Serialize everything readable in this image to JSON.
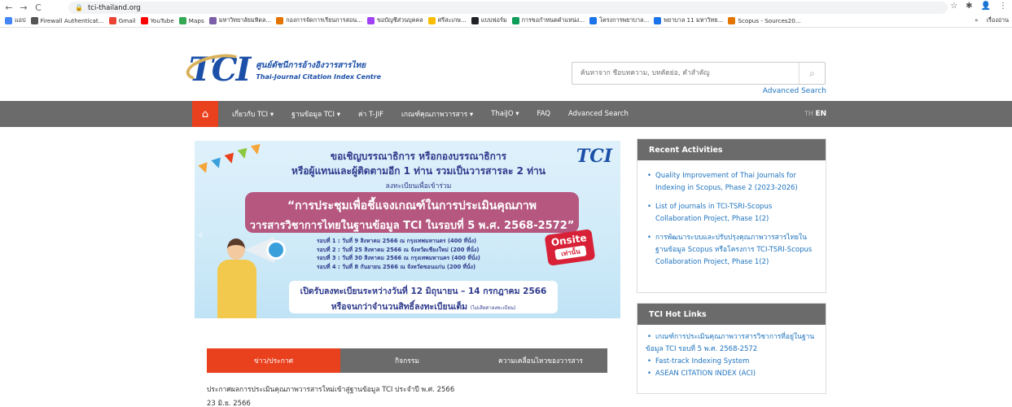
{
  "browser": {
    "url": "tci-thailand.org",
    "back": "←",
    "forward": "→",
    "reload": "C",
    "lock": "🔒",
    "right_icons": [
      "☆",
      "✱",
      "👤",
      "⋮"
    ],
    "bookmarks": [
      {
        "label": "แอป",
        "color": "#4285f4"
      },
      {
        "label": "Firewall Authenticat...",
        "color": "#555555"
      },
      {
        "label": "Gmail",
        "color": "#ea4335"
      },
      {
        "label": "YouTube",
        "color": "#ff0000"
      },
      {
        "label": "Maps",
        "color": "#34a853"
      },
      {
        "label": "มหาวิทยาลัยมหิดล...",
        "color": "#7b5ea7"
      },
      {
        "label": "กองการจัดการเรียนการสอน...",
        "color": "#e37400"
      },
      {
        "label": "ขอบัญชีส่วนบุคคล",
        "color": "#a142f4"
      },
      {
        "label": "ศรีสะเกษ...",
        "color": "#fbbc04"
      },
      {
        "label": "แบบฟอร์ม",
        "color": "#202124"
      },
      {
        "label": "การขอกำหนดตำแหน่ง...",
        "color": "#0f9d58"
      },
      {
        "label": "โครงการพยาบาล...",
        "color": "#1a73e8"
      },
      {
        "label": "พยาบาล 11 มหาวิทย...",
        "color": "#1a73e8"
      },
      {
        "label": "Scopus - Sources20...",
        "color": "#e37400"
      }
    ],
    "bookmarks_more": "»",
    "bookmarks_other": "เรื่องอ่าน"
  },
  "header": {
    "logo_mark": "TCI",
    "logo_thai": "ศูนย์ดัชนีการอ้างอิงวารสารไทย",
    "logo_eng": "Thai-Journal Citation Index Centre",
    "search_placeholder": "ค้นหาจาก ชื่อบทความ, บทคัดย่อ, คำสำคัญ",
    "search_icon": "⌕",
    "advanced_search": "Advanced Search"
  },
  "nav": {
    "home_icon": "⌂",
    "items": [
      "เกี่ยวกับ TCI ▾",
      "ฐานข้อมูล TCI ▾",
      "ค่า T-JIF",
      "เกณฑ์คุณภาพวารสาร ▾",
      "ThaiJO ▾",
      "FAQ",
      "Advanced Search"
    ],
    "lang_th": "TH",
    "lang_en": "EN"
  },
  "banner": {
    "line1": "ขอเชิญบรรณาธิการ หรือกองบรรณาธิการ",
    "line2": "หรือผู้แทนและผู้ติดตามอีก 1 ท่าน รวมเป็นวารสารละ 2 ท่าน",
    "line3": "ลงทะเบียนเพื่อเข้าร่วม",
    "logo": "TCI",
    "pill1": "“การประชุมเพื่อชี้แจงเกณฑ์ในการประเมินคุณภาพ",
    "pill2": "วารสารวิชาการไทยในฐานข้อมูล TCI ในรอบที่ 5 พ.ศ. 2568-2572”",
    "round1": "รอบที่ 1 : วันที่ 9 สิงหาคม 2566 ณ กรุงเทพมหานคร (400 ที่นั่ง)",
    "round2": "รอบที่ 2 : วันที่ 25 สิงหาคม 2566 ณ จังหวัดเชียงใหม่ (200 ที่นั่ง)",
    "round3": "รอบที่ 3 : วันที่ 30 สิงหาคม 2566 ณ กรุงเทพมหานคร (400 ที่นั่ง)",
    "round4": "รอบที่ 4 : วันที่ 8 กันยายน 2566 ณ จังหวัดขอนแก่น (200 ที่นั่ง)",
    "onsite": "Onsite",
    "onsite_sub": "เท่านั้น",
    "bottom1": "เปิดรับลงทะเบียนระหว่างวันที่ 12 มิถุนายน – 14 กรกฎาคม 2566",
    "bottom2": "หรือจนกว่าจำนวนสิทธิ์ลงทะเบียนเต็ม",
    "bottom2_small": "(ไม่เสียค่าลงทะเบียน)",
    "prev_arrow": "‹"
  },
  "tabs": [
    "ข่าว/ประกาศ",
    "กิจกรรม",
    "ความเคลื่อนไหวของวารสาร"
  ],
  "news": {
    "title": "ประกาศผลการประเมินคุณภาพวารสารใหม่เข้าสู่ฐานข้อมูล TCI ประจำปี พ.ศ. 2566",
    "date": "23 มิ.ย. 2566"
  },
  "recent": {
    "heading": "Recent Activities",
    "items": [
      "Quality Improvement of Thai Journals for Indexing in Scopus, Phase 2 (2023-2026)",
      "List of journals in TCI-TSRI-Scopus Collaboration Project, Phase 1(2)",
      "การพัฒนาระบบและปรับปรุงคุณภาพวารสารไทยในฐานข้อมูล Scopus หรือโครงการ TCI-TSRI-Scopus Collaboration Project, Phase 1(2)"
    ]
  },
  "hotlinks": {
    "heading": "TCI Hot Links",
    "item1": "เกณฑ์การประเมินคุณภาพวารสารวิชาการที่อยู่ในฐาน",
    "item1_cont": "ข้อมูล TCI รอบที่ 5 พ.ศ. 2568-2572",
    "item2": "Fast-track Indexing System",
    "item3": "ASEAN CITATION INDEX (ACI)"
  }
}
